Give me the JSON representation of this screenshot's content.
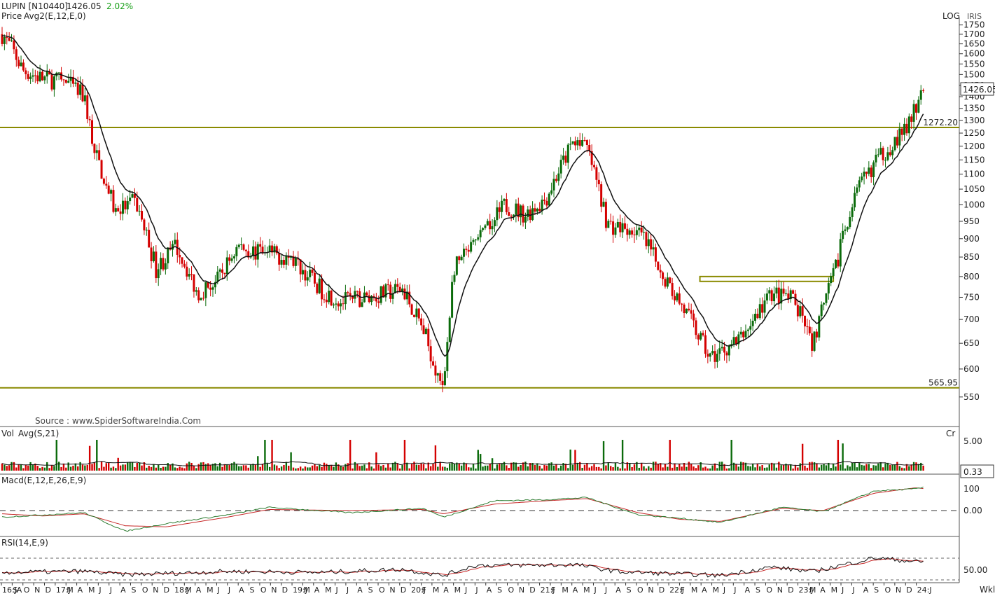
{
  "header": {
    "symbol": "LUPIN [N10440]",
    "last_price": "1426.05",
    "change_pct": "2.02%",
    "price_label": "Price",
    "avg_label": "Avg2(E,12,E,0)",
    "scale_mode": "LOG",
    "exchange": "IRIS"
  },
  "source_text": "Source : www.SpiderSoftwareIndia.Com",
  "colors": {
    "up": "#0b6b0b",
    "down": "#d40000",
    "avg_line": "#111111",
    "level_line": "#8a8a00",
    "price_tag_bg": "#ffffff",
    "macd_line": "#2e7d32",
    "signal_line": "#c62828"
  },
  "chart_data": {
    "type": "candlestick",
    "title": "LUPIN [N10440]",
    "timeframe_label": "Wkl",
    "yscale": "log",
    "ylim": [
      505,
      1760
    ],
    "y_ticks": [
      550,
      600,
      650,
      700,
      750,
      800,
      850,
      900,
      950,
      1000,
      1050,
      1100,
      1150,
      1200,
      1250,
      1300,
      1350,
      1400,
      1450,
      1500,
      1550,
      1600,
      1650,
      1700,
      1750
    ],
    "price_tag": "1426.05",
    "levels": [
      {
        "value": 1272.2,
        "label": "1272.20"
      },
      {
        "value": 565.95,
        "label": "565.95"
      }
    ],
    "zone": {
      "x_start": "2022-04",
      "x_end": "2023-05",
      "y_low": 788,
      "y_high": 800
    },
    "x_labels": [
      "16:JA",
      "S",
      "O",
      "N",
      "D",
      "17:J",
      "M",
      "A",
      "M",
      "J",
      "J",
      "A",
      "S",
      "O",
      "N",
      "D",
      "18:J",
      "M",
      "A",
      "M",
      "J",
      "J",
      "A",
      "S",
      "O",
      "N",
      "D",
      "19:J",
      "M",
      "A",
      "M",
      "J",
      "J",
      "A",
      "S",
      "O",
      "N",
      "D",
      "20:J",
      "F",
      "M",
      "A",
      "M",
      "J",
      "J",
      "A",
      "S",
      "O",
      "N",
      "D",
      "21:J",
      "F",
      "M",
      "A",
      "M",
      "J",
      "J",
      "A",
      "S",
      "O",
      "N",
      "D",
      "22:J",
      "F",
      "M",
      "A",
      "M",
      "J",
      "J",
      "A",
      "S",
      "O",
      "N",
      "D",
      "23:J",
      "M",
      "A",
      "M",
      "J",
      "J",
      "A",
      "S",
      "O",
      "N",
      "D",
      "24:J"
    ],
    "anchors": [
      {
        "date": "2016-08",
        "close": 1700
      },
      {
        "date": "2016-09",
        "close": 1620
      },
      {
        "date": "2016-10",
        "close": 1520
      },
      {
        "date": "2016-12",
        "close": 1480
      },
      {
        "date": "2017-02",
        "close": 1470
      },
      {
        "date": "2017-04",
        "close": 1400
      },
      {
        "date": "2017-05",
        "close": 1180
      },
      {
        "date": "2017-07",
        "close": 980
      },
      {
        "date": "2017-09",
        "close": 1010
      },
      {
        "date": "2017-11",
        "close": 820
      },
      {
        "date": "2018-01",
        "close": 880
      },
      {
        "date": "2018-03",
        "close": 760
      },
      {
        "date": "2018-05",
        "close": 790
      },
      {
        "date": "2018-07",
        "close": 880
      },
      {
        "date": "2018-09",
        "close": 860
      },
      {
        "date": "2018-12",
        "close": 850
      },
      {
        "date": "2019-03",
        "close": 770
      },
      {
        "date": "2019-05",
        "close": 740
      },
      {
        "date": "2019-08",
        "close": 750
      },
      {
        "date": "2019-11",
        "close": 770
      },
      {
        "date": "2020-01",
        "close": 680
      },
      {
        "date": "2020-03",
        "close": 555
      },
      {
        "date": "2020-04",
        "close": 820
      },
      {
        "date": "2020-07",
        "close": 910
      },
      {
        "date": "2020-09",
        "close": 1000
      },
      {
        "date": "2020-11",
        "close": 970
      },
      {
        "date": "2021-01",
        "close": 1020
      },
      {
        "date": "2021-04",
        "close": 1240
      },
      {
        "date": "2021-05",
        "close": 1190
      },
      {
        "date": "2021-07",
        "close": 940
      },
      {
        "date": "2021-10",
        "close": 920
      },
      {
        "date": "2022-01",
        "close": 780
      },
      {
        "date": "2022-03",
        "close": 700
      },
      {
        "date": "2022-05",
        "close": 620
      },
      {
        "date": "2022-08",
        "close": 660
      },
      {
        "date": "2022-11",
        "close": 760
      },
      {
        "date": "2023-01",
        "close": 745
      },
      {
        "date": "2023-03",
        "close": 650
      },
      {
        "date": "2023-05",
        "close": 800
      },
      {
        "date": "2023-07",
        "close": 1020
      },
      {
        "date": "2023-09",
        "close": 1140
      },
      {
        "date": "2023-12",
        "close": 1260
      },
      {
        "date": "2024-02",
        "close": 1426.05
      }
    ],
    "volume": {
      "label": "Vol",
      "avg_label": "Avg(S,21)",
      "scale_label": "Cr",
      "tick": "5.00",
      "last": "0.33"
    },
    "macd": {
      "label": "Macd(E,12,E,26,E,9)",
      "ticks": [
        "100",
        "0.00"
      ],
      "anchors": [
        {
          "date": "2016-08",
          "macd": -30,
          "signal": -15
        },
        {
          "date": "2016-12",
          "macd": -20,
          "signal": -25
        },
        {
          "date": "2017-04",
          "macd": -10,
          "signal": -15
        },
        {
          "date": "2017-08",
          "macd": -95,
          "signal": -70
        },
        {
          "date": "2017-12",
          "macd": -60,
          "signal": -75
        },
        {
          "date": "2018-06",
          "macd": -20,
          "signal": -30
        },
        {
          "date": "2018-10",
          "macd": 15,
          "signal": 5
        },
        {
          "date": "2019-06",
          "macd": -10,
          "signal": 0
        },
        {
          "date": "2020-01",
          "macd": 10,
          "signal": 5
        },
        {
          "date": "2020-03",
          "macd": -30,
          "signal": -15
        },
        {
          "date": "2020-08",
          "macd": 45,
          "signal": 30
        },
        {
          "date": "2021-01",
          "macd": 50,
          "signal": 45
        },
        {
          "date": "2021-05",
          "macd": 60,
          "signal": 55
        },
        {
          "date": "2021-10",
          "macd": -20,
          "signal": -10
        },
        {
          "date": "2022-02",
          "macd": -35,
          "signal": -40
        },
        {
          "date": "2022-06",
          "macd": -55,
          "signal": -50
        },
        {
          "date": "2022-12",
          "macd": 15,
          "signal": 10
        },
        {
          "date": "2023-04",
          "macd": -5,
          "signal": 0
        },
        {
          "date": "2023-09",
          "macd": 90,
          "signal": 80
        },
        {
          "date": "2024-01",
          "macd": 100,
          "signal": 105
        },
        {
          "date": "2024-02",
          "macd": 108,
          "signal": 100
        }
      ]
    },
    "rsi": {
      "label": "RSI(14,E,9)",
      "tick": "50.00",
      "anchors": [
        {
          "date": "2016-08",
          "rsi": 42
        },
        {
          "date": "2017-04",
          "rsi": 45
        },
        {
          "date": "2017-08",
          "rsi": 36
        },
        {
          "date": "2018-06",
          "rsi": 45
        },
        {
          "date": "2019-03",
          "rsi": 42
        },
        {
          "date": "2019-11",
          "rsi": 50
        },
        {
          "date": "2020-03",
          "rsi": 34
        },
        {
          "date": "2020-06",
          "rsi": 60
        },
        {
          "date": "2021-04",
          "rsi": 62
        },
        {
          "date": "2021-08",
          "rsi": 44
        },
        {
          "date": "2022-06",
          "rsi": 34
        },
        {
          "date": "2022-11",
          "rsi": 56
        },
        {
          "date": "2023-03",
          "rsi": 44
        },
        {
          "date": "2023-09",
          "rsi": 80
        },
        {
          "date": "2024-02",
          "rsi": 68
        }
      ]
    }
  }
}
